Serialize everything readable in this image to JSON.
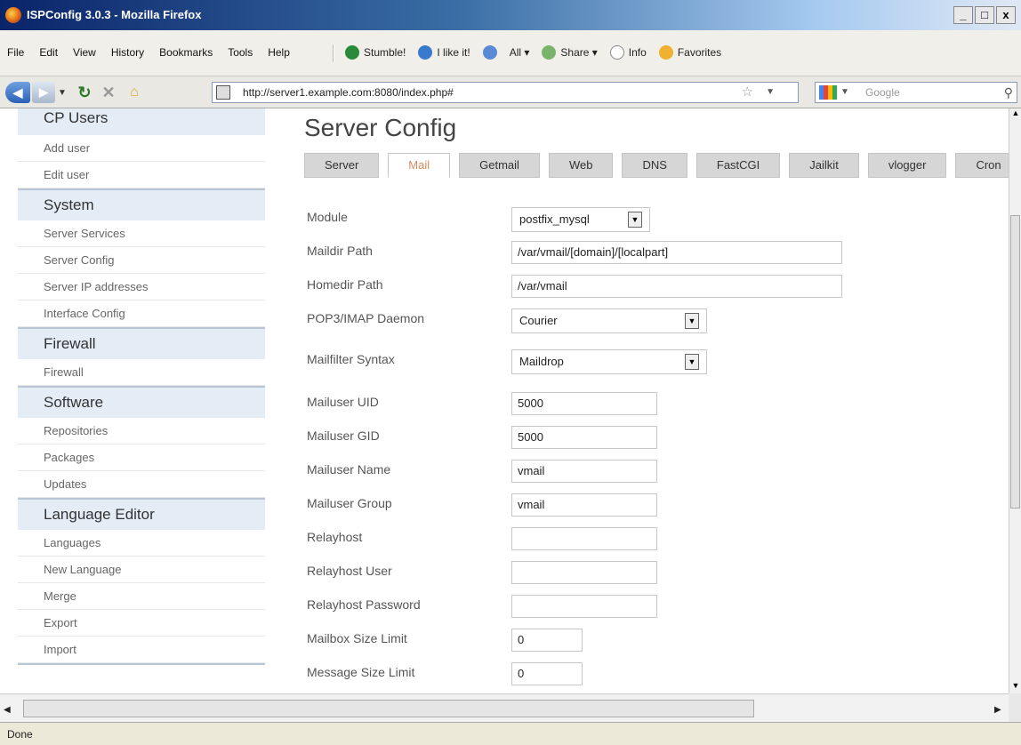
{
  "window": {
    "title": "ISPConfig 3.0.3 - Mozilla Firefox",
    "controls": [
      "_",
      "□",
      "x"
    ]
  },
  "menu": [
    "File",
    "Edit",
    "View",
    "History",
    "Bookmarks",
    "Tools",
    "Help"
  ],
  "toolbar": {
    "stumble": "Stumble!",
    "ilike": "I like it!",
    "all": "All ▾",
    "share": "Share ▾",
    "info": "Info",
    "favorites": "Favorites"
  },
  "nav": {
    "url": "http://server1.example.com:8080/index.php#",
    "search_placeholder": "Google"
  },
  "sidebar": [
    {
      "title": "CP Users",
      "items": [
        "Add user",
        "Edit user"
      ]
    },
    {
      "title": "System",
      "items": [
        "Server Services",
        "Server Config",
        "Server IP addresses",
        "Interface Config"
      ]
    },
    {
      "title": "Firewall",
      "items": [
        "Firewall"
      ]
    },
    {
      "title": "Software",
      "items": [
        "Repositories",
        "Packages",
        "Updates"
      ]
    },
    {
      "title": "Language Editor",
      "items": [
        "Languages",
        "New Language",
        "Merge",
        "Export",
        "Import"
      ]
    }
  ],
  "main": {
    "title": "Server Config",
    "tabs": [
      "Server",
      "Mail",
      "Getmail",
      "Web",
      "DNS",
      "FastCGI",
      "Jailkit",
      "vlogger",
      "Cron"
    ],
    "active_tab": "Mail",
    "fields": [
      {
        "label": "Module",
        "type": "select",
        "value": "postfix_mysql"
      },
      {
        "label": "Maildir Path",
        "type": "text",
        "value": "/var/vmail/[domain]/[localpart]"
      },
      {
        "label": "Homedir Path",
        "type": "text",
        "value": "/var/vmail"
      },
      {
        "label": "POP3/IMAP Daemon",
        "type": "select",
        "value": "Courier"
      },
      {
        "label": "Mailfilter Syntax",
        "type": "select",
        "value": "Maildrop"
      },
      {
        "label": "Mailuser UID",
        "type": "text",
        "value": "5000"
      },
      {
        "label": "Mailuser GID",
        "type": "text",
        "value": "5000"
      },
      {
        "label": "Mailuser Name",
        "type": "text",
        "value": "vmail"
      },
      {
        "label": "Mailuser Group",
        "type": "text",
        "value": "vmail"
      },
      {
        "label": "Relayhost",
        "type": "text",
        "value": ""
      },
      {
        "label": "Relayhost User",
        "type": "text",
        "value": ""
      },
      {
        "label": "Relayhost Password",
        "type": "text",
        "value": ""
      },
      {
        "label": "Mailbox Size Limit",
        "type": "text",
        "value": "0"
      },
      {
        "label": "Message Size Limit",
        "type": "text",
        "value": "0"
      }
    ]
  },
  "status": "Done"
}
